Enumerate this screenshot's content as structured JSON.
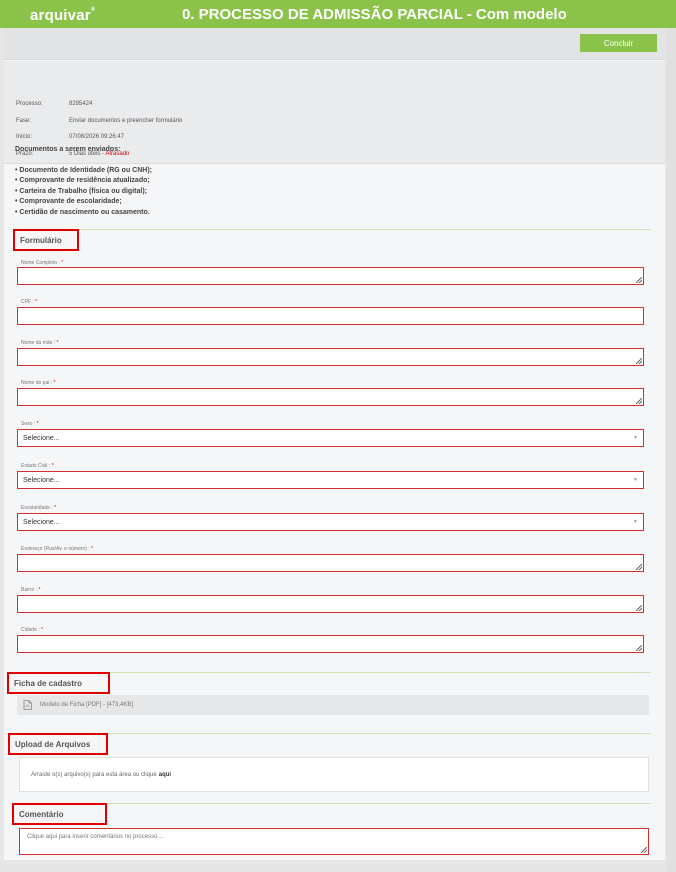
{
  "header": {
    "logo": "arquivar",
    "logo_mark": "®",
    "title": "0. PROCESSO DE ADMISSÃO PARCIAL - Com modelo"
  },
  "actions": {
    "concluir_label": "Concluir"
  },
  "info": {
    "processo_label": "Processo:",
    "processo_value": "8295424",
    "fase_label": "Fase:",
    "fase_value": "Enviar documentos e preencher formulário",
    "inicio_label": "Início:",
    "inicio_value": "07/08/2026 09:26:47",
    "prazo_label": "Prazo:",
    "prazo_value": "5 Dias úteis - ",
    "prazo_status": "Atrasado"
  },
  "documents": {
    "heading": "Documentos a serem enviados:",
    "items": [
      "• Documento de Identidade (RG ou CNH);",
      "• Comprovante de residência atualizado;",
      "• Carteira de Trabalho (física ou digital);",
      "• Comprovante de escolaridade;",
      "• Certidão de nascimento ou casamento."
    ]
  },
  "form": {
    "title": "Formulário",
    "required_mark": "*",
    "select_placeholder": "Selecione...",
    "fields": [
      {
        "label": "Nome Completo :"
      },
      {
        "label": "CPF :"
      },
      {
        "label": "Nome da mãe :"
      },
      {
        "label": "Nome do pai :"
      },
      {
        "label": "Sexo :"
      },
      {
        "label": "Estado Civil :"
      },
      {
        "label": "Escolaridade :"
      },
      {
        "label": "Endereço (Rua/Av. e número) :"
      },
      {
        "label": "Bairro :"
      },
      {
        "label": "Cidade :"
      }
    ]
  },
  "ficha": {
    "title": "Ficha de cadastro",
    "file_label": "Modelo de Ficha [PDF] - [473,4KB]"
  },
  "upload": {
    "title": "Upload de Arquivos",
    "prompt": "Arraste o(s) arquivo(s) para esta área ou clique",
    "link": "aqui"
  },
  "comment": {
    "title": "Comentário",
    "placeholder": "Clique aqui para inserir comentários no processo ..."
  },
  "colors": {
    "brand": "#8bc34a",
    "error": "#d32f2f",
    "late": "#d50000"
  },
  "icons": [
    "pdf-file-icon",
    "chevron-down-icon",
    "resize-handle-icon"
  ]
}
